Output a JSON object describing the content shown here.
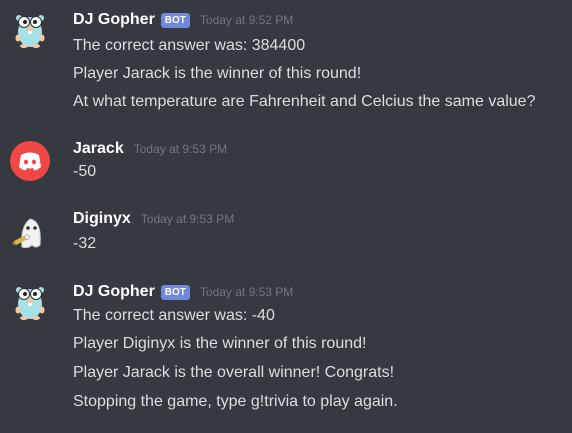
{
  "messages": [
    {
      "author": "DJ Gopher",
      "bot_tag": "BOT",
      "timestamp": "Today at 9:52 PM",
      "avatar_icon": "gopher-avatar-icon",
      "lines": [
        "The correct answer was: 384400",
        "Player Jarack is the winner of this round!",
        "At what temperature are Fahrenheit and Celcius the same value?"
      ]
    },
    {
      "author": "Jarack",
      "timestamp": "Today at 9:53 PM",
      "avatar_icon": "discord-logo-avatar-icon",
      "lines": [
        "-50"
      ]
    },
    {
      "author": "Diginyx",
      "timestamp": "Today at 9:53 PM",
      "avatar_icon": "ghost-avatar-icon",
      "lines": [
        "-32"
      ]
    },
    {
      "author": "DJ Gopher",
      "bot_tag": "BOT",
      "timestamp": "Today at 9:53 PM",
      "avatar_icon": "gopher-avatar-icon",
      "lines": [
        "The correct answer was: -40",
        "Player Diginyx is the winner of this round!",
        "Player Jarack is the overall winner! Congrats!",
        "Stopping the game, type g!trivia to play again."
      ]
    }
  ],
  "colors": {
    "background": "#36393f",
    "username": "#ffffff",
    "message_text": "#dcddde",
    "timestamp": "#72767d",
    "bot_tag": "#7289da",
    "discord_red": "#f04747",
    "gopher_cyan": "#a6e0e8"
  }
}
